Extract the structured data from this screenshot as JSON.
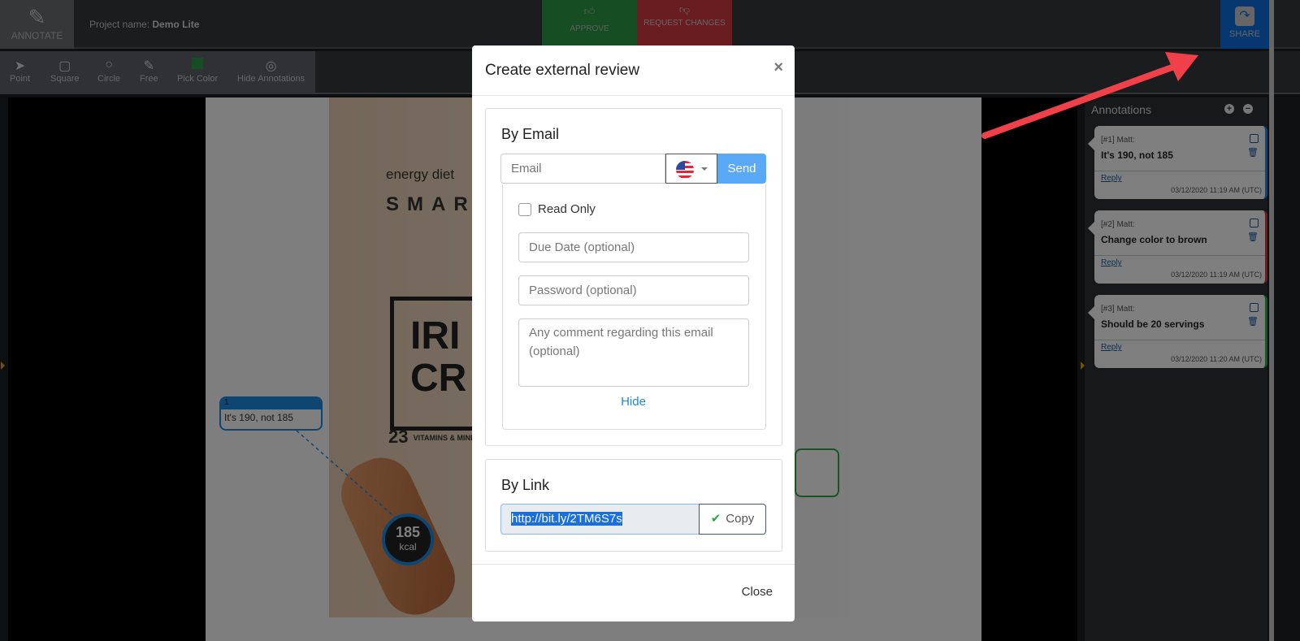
{
  "topbar": {
    "annotate_label": "ANNOTATE",
    "project_label": "Project name:",
    "project_name": "Demo Lite",
    "approve_label": "APPROVE",
    "request_changes_label": "REQUEST CHANGES",
    "share_label": "SHARE"
  },
  "toolbar": {
    "tools": [
      {
        "label": "Point",
        "icon": "cursor-icon"
      },
      {
        "label": "Square",
        "icon": "square-icon"
      },
      {
        "label": "Circle",
        "icon": "circle-icon"
      },
      {
        "label": "Free",
        "icon": "pencil-icon"
      },
      {
        "label": "Pick Color",
        "icon": "color-swatch-icon",
        "color": "#2e9a45"
      },
      {
        "label": "Hide Annotations",
        "icon": "eye-slash-icon"
      }
    ]
  },
  "canvas": {
    "annotation_number": "1",
    "annotation_text": "It's 190, not 185",
    "kcal_value": "185",
    "kcal_unit": "kcal",
    "brand": "energy diet",
    "line": "SMAR",
    "product": "IRI CR",
    "vitamins_count": "23",
    "vitamins_text": "VITAMINS & MINERALS"
  },
  "annotations_panel": {
    "title": "Annotations",
    "items": [
      {
        "author": "[#1] Matt:",
        "message": "It's 190, not 185",
        "reply": "Reply",
        "time": "03/12/2020 11:19 AM (UTC)",
        "color": "#1a8be6"
      },
      {
        "author": "[#2] Matt:",
        "message": "Change color to brown",
        "reply": "Reply",
        "time": "03/12/2020 11:19 AM (UTC)",
        "color": "#d23a42"
      },
      {
        "author": "[#3] Matt:",
        "message": "Should be 20 servings",
        "reply": "Reply",
        "time": "03/12/2020 11:20 AM (UTC)",
        "color": "#2eaa45"
      }
    ]
  },
  "modal": {
    "title": "Create external review",
    "close_icon": "×",
    "by_email": {
      "heading": "By Email",
      "email_placeholder": "Email",
      "send_label": "Send",
      "read_only_label": "Read Only",
      "due_date_placeholder": "Due Date (optional)",
      "password_placeholder": "Password (optional)",
      "comment_placeholder": "Any comment regarding this email (optional)",
      "hide_label": "Hide"
    },
    "by_link": {
      "heading": "By Link",
      "link_value": "http://bit.ly/2TM6S7s",
      "copy_label": "Copy"
    },
    "close_label": "Close"
  }
}
